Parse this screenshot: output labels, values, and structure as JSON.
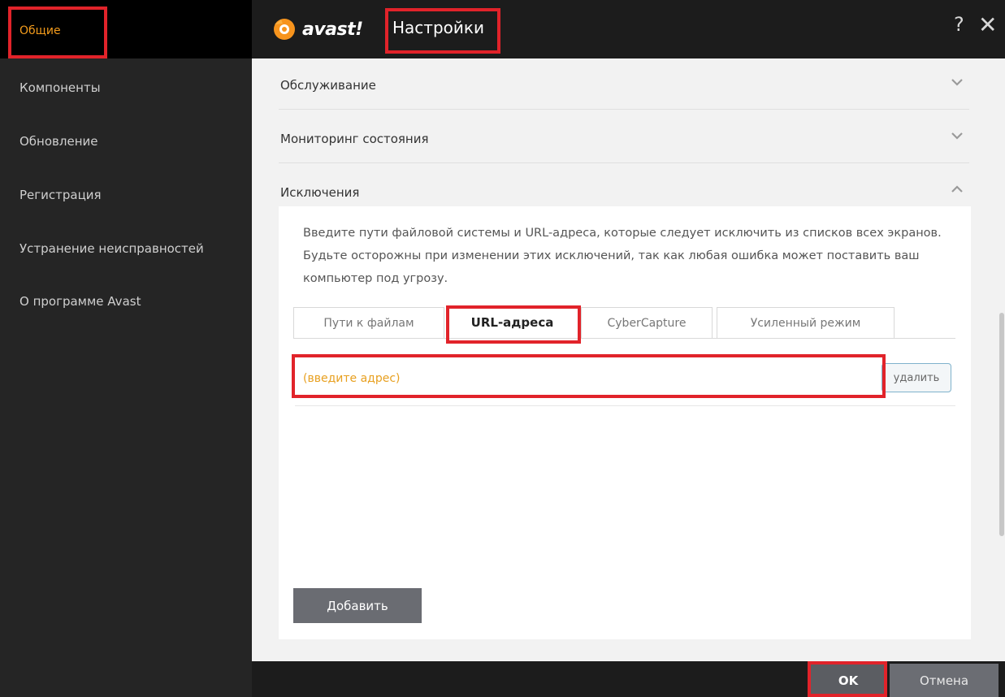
{
  "sidebar": {
    "active": "Общие",
    "items": [
      {
        "label": "Компоненты"
      },
      {
        "label": "Обновление"
      },
      {
        "label": "Регистрация"
      },
      {
        "label": "Устранение неисправностей"
      },
      {
        "label": "О программе Avast"
      }
    ]
  },
  "header": {
    "logo_text": "avast!",
    "title": "Настройки",
    "help": "?",
    "close": "✕"
  },
  "sections": [
    {
      "label": "Обслуживание",
      "chevron": "⌄"
    },
    {
      "label": "Мониторинг состояния",
      "chevron": "⌄"
    },
    {
      "label": "Исключения",
      "chevron": "⌃"
    }
  ],
  "exclusions": {
    "description": "Введите пути файловой системы и URL-адреса, которые следует исключить из списков всех экранов. Будьте осторожны при изменении этих исключений, так как любая ошибка может поставить ваш компьютер под угрозу.",
    "tabs": [
      {
        "label": "Пути к файлам"
      },
      {
        "label": "URL-адреса"
      },
      {
        "label": "CyberCapture"
      },
      {
        "label": "Усиленный режим"
      }
    ],
    "active_tab": "URL-адреса",
    "url_placeholder": "(введите адрес)",
    "delete_label": "удалить",
    "add_label": "Добавить"
  },
  "footer": {
    "ok_label": "OK",
    "cancel_label": "Отмена"
  },
  "colors": {
    "sidebar_bg": "#252525",
    "active_text": "#f39b1c",
    "highlight": "#e1232a",
    "placeholder": "#e8a020",
    "logo_orange": "#f7941d"
  },
  "icons": {
    "logo": "avast-logo-icon",
    "help": "help-icon",
    "close": "close-icon",
    "chevron_down": "chevron-down-icon",
    "chevron_up": "chevron-up-icon"
  }
}
